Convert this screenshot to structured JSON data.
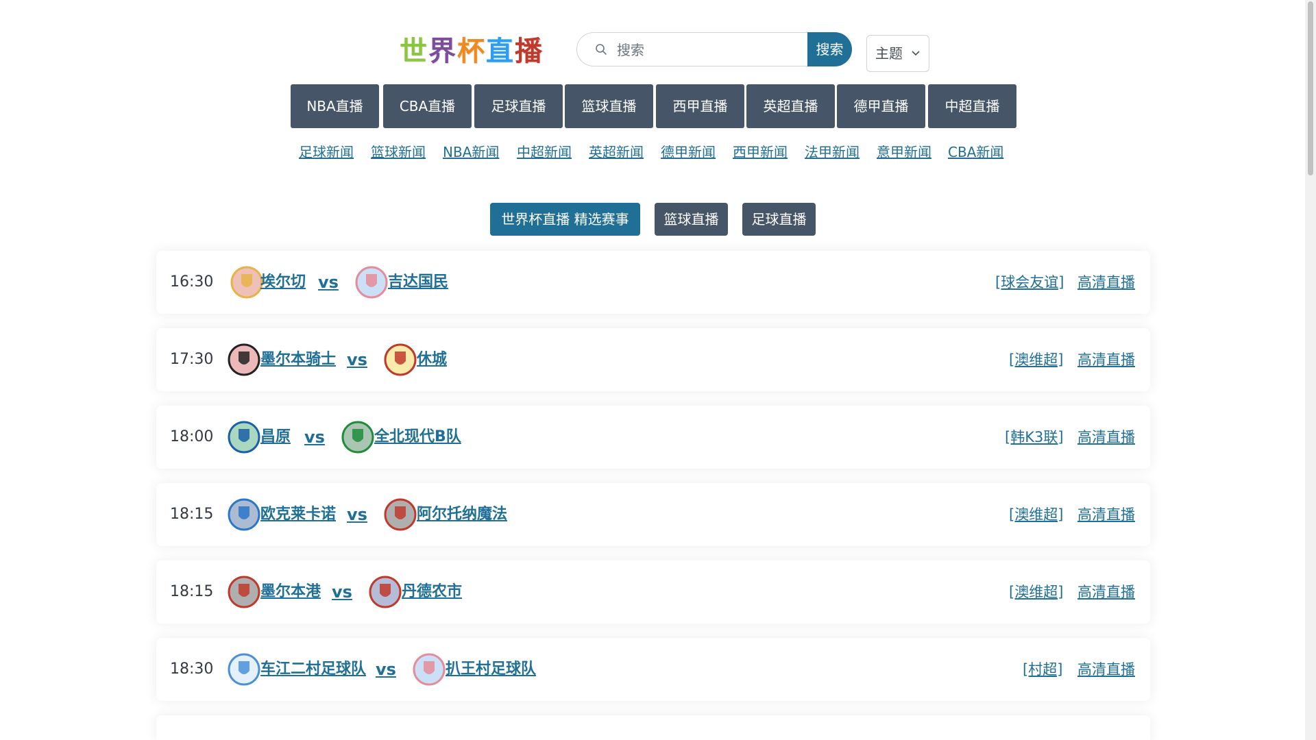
{
  "header": {
    "logo_chars": [
      "世",
      "界",
      "杯",
      "直",
      "播"
    ],
    "search": {
      "placeholder": "搜索",
      "button_label": "搜索"
    },
    "theme_label": "主题"
  },
  "nav": {
    "buttons": [
      "NBA直播",
      "CBA直播",
      "足球直播",
      "篮球直播",
      "西甲直播",
      "英超直播",
      "德甲直播",
      "中超直播"
    ],
    "news_links": [
      "足球新闻",
      "篮球新闻",
      "NBA新闻",
      "中超新闻",
      "英超新闻",
      "德甲新闻",
      "西甲新闻",
      "法甲新闻",
      "意甲新闻",
      "CBA新闻"
    ]
  },
  "filters": {
    "primary": "世界杯直播 精选赛事",
    "basketball": "篮球直播",
    "football": "足球直播"
  },
  "matches": [
    {
      "time": "16:30",
      "home": "埃尔切",
      "vs": "vs",
      "away": "吉达国民",
      "league": "[球会友谊]",
      "live": "高清直播"
    },
    {
      "time": "17:30",
      "home": "墨尔本骑士",
      "vs": "vs",
      "away": "休城",
      "league": "[澳维超]",
      "live": "高清直播"
    },
    {
      "time": "18:00",
      "home": "昌原",
      "vs": "vs",
      "away": "全北现代B队",
      "league": "[韩K3联]",
      "live": "高清直播"
    },
    {
      "time": "18:15",
      "home": "欧克莱卡诺",
      "vs": "vs",
      "away": "阿尔托纳魔法",
      "league": "[澳维超]",
      "live": "高清直播"
    },
    {
      "time": "18:15",
      "home": "墨尔本港",
      "vs": "vs",
      "away": "丹德农市",
      "league": "[澳维超]",
      "live": "高清直播"
    },
    {
      "time": "18:30",
      "home": "车江二村足球队",
      "vs": "vs",
      "away": "扒王村足球队",
      "league": "[村超]",
      "live": "高清直播"
    }
  ],
  "colors": {
    "accent": "#1f6f97",
    "nav_bg": "#475569",
    "logo": [
      "#8cc63f",
      "#7d4d9c",
      "#f08a1c",
      "#2a9df4",
      "#c0392b"
    ]
  },
  "icons": [
    "search-icon",
    "chevron-down-icon",
    "team-crest-icon"
  ]
}
